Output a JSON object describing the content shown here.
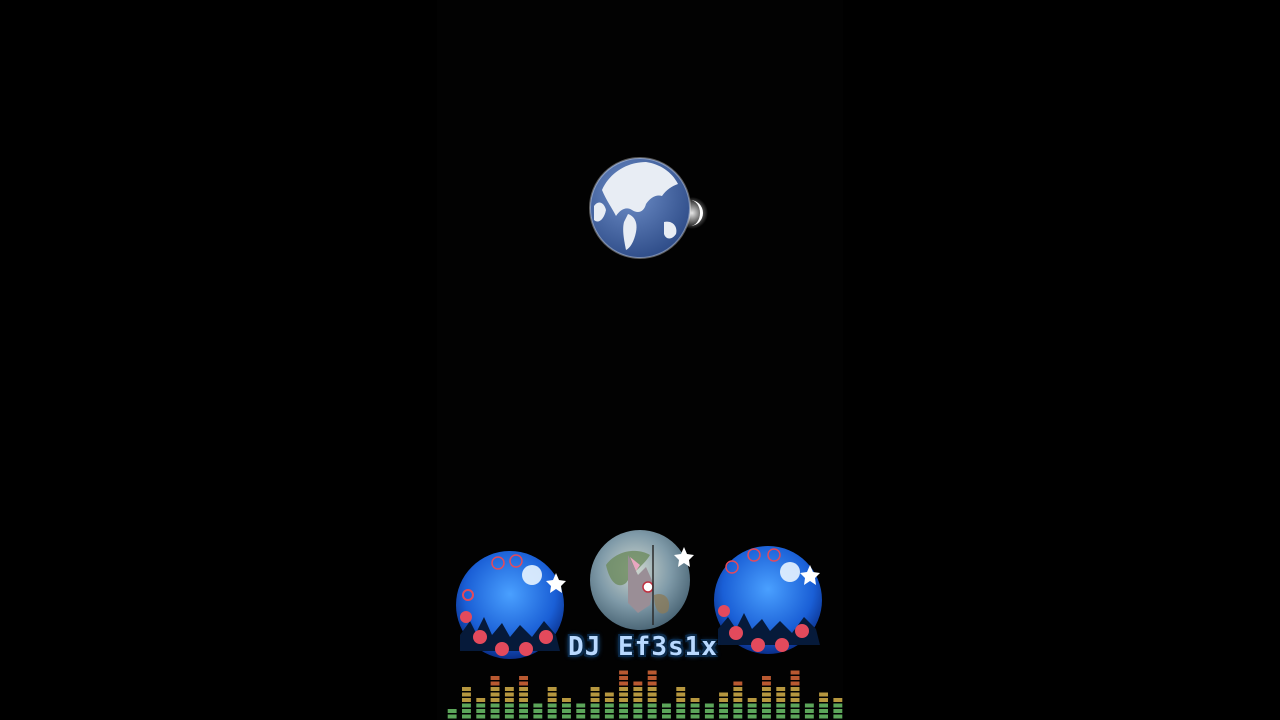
{
  "overlay": {
    "dj_name": "DJ Ef3s1x"
  },
  "colors": {
    "background": "#000000",
    "globe_ocean": "#3e5f9c",
    "globe_land": "#e8edf4",
    "orb_blue": "#1f6fe0",
    "orb_dots": "#e34a5c",
    "eq_low": "#6cc36a",
    "eq_mid": "#d6b24a",
    "eq_high": "#d9683a"
  },
  "equalizer": {
    "levels": [
      0.2,
      0.55,
      0.35,
      0.75,
      0.6,
      0.8,
      0.25,
      0.55,
      0.4,
      0.3,
      0.6,
      0.45,
      0.85,
      0.7,
      0.9,
      0.3,
      0.55,
      0.4,
      0.25,
      0.5,
      0.65,
      0.35,
      0.8,
      0.55,
      0.85,
      0.3,
      0.5,
      0.4
    ]
  }
}
